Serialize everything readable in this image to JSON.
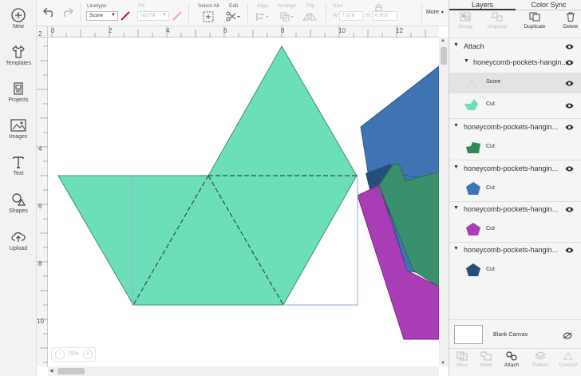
{
  "sidebar": {
    "items": [
      {
        "label": "New",
        "icon": "plus-circle-icon"
      },
      {
        "label": "Templates",
        "icon": "shirt-icon"
      },
      {
        "label": "Projects",
        "icon": "projects-icon"
      },
      {
        "label": "Images",
        "icon": "image-icon"
      },
      {
        "label": "Text",
        "icon": "text-icon"
      },
      {
        "label": "Shapes",
        "icon": "shapes-icon"
      },
      {
        "label": "Upload",
        "icon": "upload-icon"
      }
    ]
  },
  "toolbar": {
    "linetype_label": "Linetype",
    "linetype_value": "Score",
    "fill_label": "Fill",
    "fill_value": "No Fill",
    "select_all_label": "Select All",
    "edit_label": "Edit",
    "align_label": "Align",
    "arrange_label": "Arrange",
    "flip_label": "Flip",
    "size_label": "Size",
    "w_label": "W",
    "w_value": "7.876",
    "h_label": "H",
    "h_value": "6.905",
    "more_label": "More"
  },
  "rulers": {
    "top": [
      "0",
      "2",
      "4",
      "6",
      "8",
      "10",
      "12"
    ],
    "left": [
      "2",
      "4",
      "6",
      "8",
      "10"
    ]
  },
  "zoom": {
    "value": "75%",
    "minus": "−",
    "plus": "+"
  },
  "panel": {
    "tabs": {
      "layers": "Layers",
      "color_sync": "Color Sync"
    },
    "actions": {
      "group": "Group",
      "ungroup": "Ungroup",
      "duplicate": "Duplicate",
      "delete": "Delete"
    },
    "layers": {
      "attach_label": "Attach",
      "group_name": "honeycomb-pockets-hangin...",
      "sub_score": "Score",
      "sub_cut": "Cut",
      "items": [
        {
          "name": "honeycomb-pockets-hangin...",
          "sub": "Cut",
          "color": "#2e8b57",
          "shape": "pentagon-wide"
        },
        {
          "name": "honeycomb-pockets-hangin...",
          "sub": "Cut",
          "color": "#3f74b3",
          "shape": "pentagon"
        },
        {
          "name": "honeycomb-pockets-hangin...",
          "sub": "Cut",
          "color": "#a83db5",
          "shape": "pentagon"
        },
        {
          "name": "honeycomb-pockets-hangin...",
          "sub": "Cut",
          "color": "#254f7a",
          "shape": "pentagon"
        }
      ]
    },
    "blank_canvas": "Blank Canvas",
    "bottom": {
      "slice": "Slice",
      "weld": "Weld",
      "attach": "Attach",
      "flatten": "Flatten",
      "contour": "Contour"
    }
  },
  "colors": {
    "green": "#6ddfb8",
    "blue": "#3f74b3",
    "dark_green": "#3a8f6d",
    "purple": "#a83db5",
    "navy": "#254f7a"
  }
}
